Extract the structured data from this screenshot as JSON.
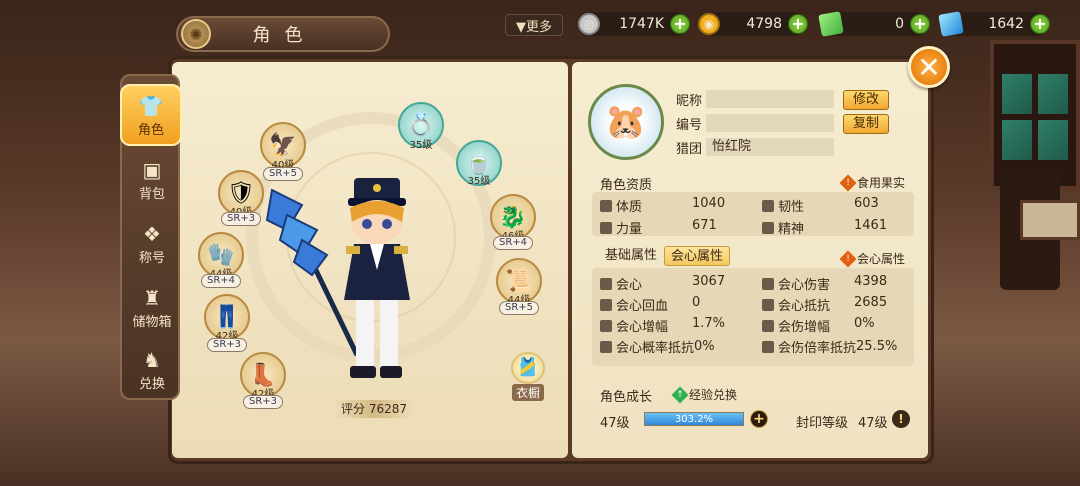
{
  "header": {
    "title": "角色",
    "more_label": "▼更多",
    "currencies": [
      {
        "name": "silver",
        "value": "1747K",
        "icon": "silver-coin-icon",
        "color": "#c8c8c8"
      },
      {
        "name": "gold",
        "value": "4798",
        "icon": "gold-coin-icon",
        "color": "#f0b020"
      },
      {
        "name": "green-gem",
        "value": "0",
        "icon": "green-crystal-icon",
        "color": "#60d860"
      },
      {
        "name": "blue-gem",
        "value": "1642",
        "icon": "blue-diamond-icon",
        "color": "#40b8f8"
      }
    ]
  },
  "sidebar": {
    "items": [
      {
        "label": "角色",
        "icon": "armor-icon",
        "active": true
      },
      {
        "label": "背包",
        "icon": "bag-icon",
        "active": false
      },
      {
        "label": "称号",
        "icon": "title-icon",
        "active": false
      },
      {
        "label": "储物箱",
        "icon": "storage-icon",
        "active": false
      },
      {
        "label": "兑换",
        "icon": "exchange-icon",
        "active": false
      }
    ]
  },
  "equipment": [
    {
      "level": "40级",
      "rank": "SR+5",
      "icon": "helmet-icon"
    },
    {
      "level": "40级",
      "rank": "SR+3",
      "icon": "armor-icon"
    },
    {
      "level": "44级",
      "rank": "SR+4",
      "icon": "gloves-icon"
    },
    {
      "level": "42级",
      "rank": "SR+3",
      "icon": "pants-icon"
    },
    {
      "level": "42级",
      "rank": "SR+3",
      "icon": "boots-icon"
    },
    {
      "level": "35级",
      "rank": "",
      "icon": "ring-icon"
    },
    {
      "level": "35级",
      "rank": "",
      "icon": "bowl-icon"
    },
    {
      "level": "46级",
      "rank": "SR+4",
      "icon": "pet-icon"
    },
    {
      "level": "44级",
      "rank": "SR+5",
      "icon": "scroll-icon"
    }
  ],
  "score_label": "评分",
  "score": "76287",
  "wardrobe_label": "衣橱",
  "profile": {
    "nickname_label": "昵称",
    "id_label": "编号",
    "guild_label": "猎团",
    "guild_value": "怡红院",
    "edit_btn": "修改",
    "copy_btn": "复制"
  },
  "aptitude": {
    "title": "角色资质",
    "food_btn": "食用果实",
    "stats": [
      {
        "label": "体质",
        "value": "1040"
      },
      {
        "label": "韧性",
        "value": "603"
      },
      {
        "label": "力量",
        "value": "671"
      },
      {
        "label": "精神",
        "value": "1461"
      }
    ]
  },
  "attributes": {
    "tab_basic": "基础属性",
    "tab_crit": "会心属性",
    "crit_btn": "会心属性",
    "stats": [
      {
        "label": "会心",
        "value": "3067"
      },
      {
        "label": "会心伤害",
        "value": "4398"
      },
      {
        "label": "会心回血",
        "value": "0"
      },
      {
        "label": "会心抵抗",
        "value": "2685"
      },
      {
        "label": "会心增幅",
        "value": "1.7%"
      },
      {
        "label": "会伤增幅",
        "value": "0%"
      },
      {
        "label": "会心概率抵抗",
        "value": "0%"
      },
      {
        "label": "会伤倍率抵抗",
        "value": "25.5%"
      }
    ]
  },
  "growth": {
    "title": "角色成长",
    "exp_exchange": "经验兑换",
    "level": "47级",
    "exp_percent": "303.2%",
    "exp_fill": 1.0,
    "seal_label": "封印等级",
    "seal_level": "47级"
  }
}
